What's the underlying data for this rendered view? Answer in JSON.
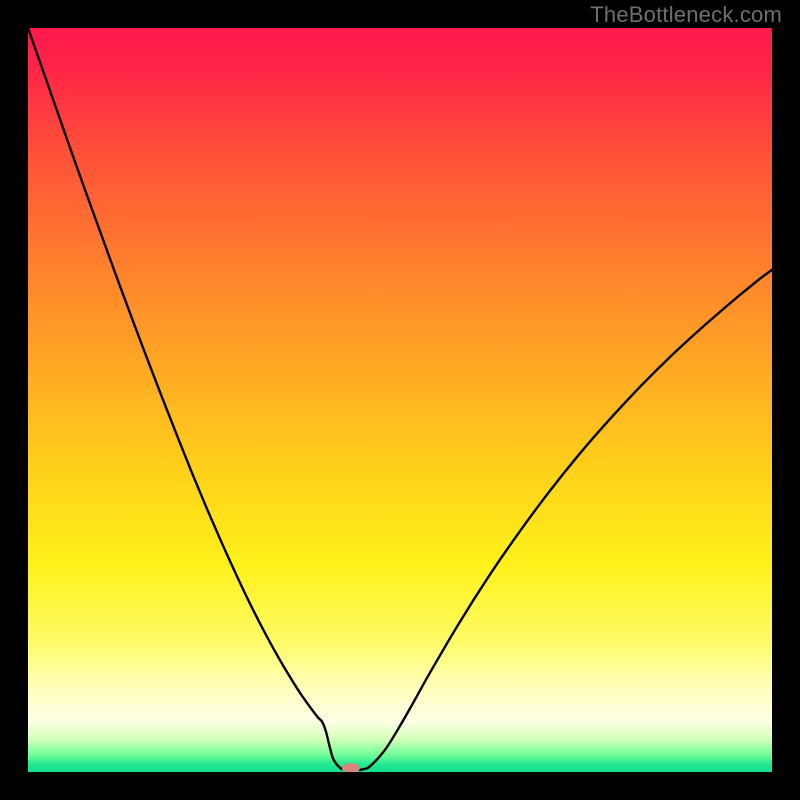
{
  "watermark": "TheBottleneck.com",
  "chart_data": {
    "type": "line",
    "title": "",
    "xlabel": "",
    "ylabel": "",
    "xlim": [
      0,
      100
    ],
    "ylim": [
      0,
      100
    ],
    "grid": false,
    "legend": false,
    "background_gradient_stops": [
      {
        "pos": 0.0,
        "color": "#ff1a4d"
      },
      {
        "pos": 0.05,
        "color": "#ff2348"
      },
      {
        "pos": 0.15,
        "color": "#ff4a3a"
      },
      {
        "pos": 0.3,
        "color": "#ff7a2f"
      },
      {
        "pos": 0.45,
        "color": "#ffa724"
      },
      {
        "pos": 0.6,
        "color": "#ffd21a"
      },
      {
        "pos": 0.72,
        "color": "#fff11a"
      },
      {
        "pos": 0.82,
        "color": "#fffb63"
      },
      {
        "pos": 0.885,
        "color": "#ffffb8"
      },
      {
        "pos": 0.93,
        "color": "#ffffe6"
      },
      {
        "pos": 0.955,
        "color": "#d7ffba"
      },
      {
        "pos": 0.975,
        "color": "#7aff9a"
      },
      {
        "pos": 0.99,
        "color": "#22e890"
      },
      {
        "pos": 1.0,
        "color": "#11df8c"
      }
    ],
    "series": [
      {
        "name": "bottleneck-curve",
        "x": [
          0,
          2,
          4,
          6,
          8,
          10,
          12,
          14,
          16,
          18,
          20,
          22,
          24,
          26,
          28,
          30,
          32,
          34,
          36,
          37,
          38,
          39,
          39.5,
          40,
          40.6,
          41,
          41.6,
          42.2,
          43,
          44,
          45,
          46,
          48,
          50,
          52,
          54,
          58,
          62,
          66,
          70,
          74,
          78,
          82,
          86,
          90,
          94,
          98,
          100
        ],
        "values": [
          100,
          94.3,
          88.6,
          82.9,
          77.3,
          71.8,
          66.3,
          60.9,
          55.6,
          50.4,
          45.3,
          40.3,
          35.5,
          30.9,
          26.5,
          22.3,
          18.4,
          14.8,
          11.5,
          10.0,
          8.6,
          7.3,
          6.8,
          5.6,
          3.2,
          1.8,
          0.9,
          0.4,
          0.32,
          0.3,
          0.35,
          0.8,
          3.0,
          6.2,
          9.7,
          13.3,
          20.1,
          26.4,
          32.2,
          37.6,
          42.6,
          47.2,
          51.5,
          55.5,
          59.2,
          62.7,
          66.0,
          67.5
        ]
      }
    ],
    "marker": {
      "x": 43.4,
      "y": 0.5,
      "color": "#d9857f",
      "rx": 1.2,
      "ry": 0.7
    }
  }
}
